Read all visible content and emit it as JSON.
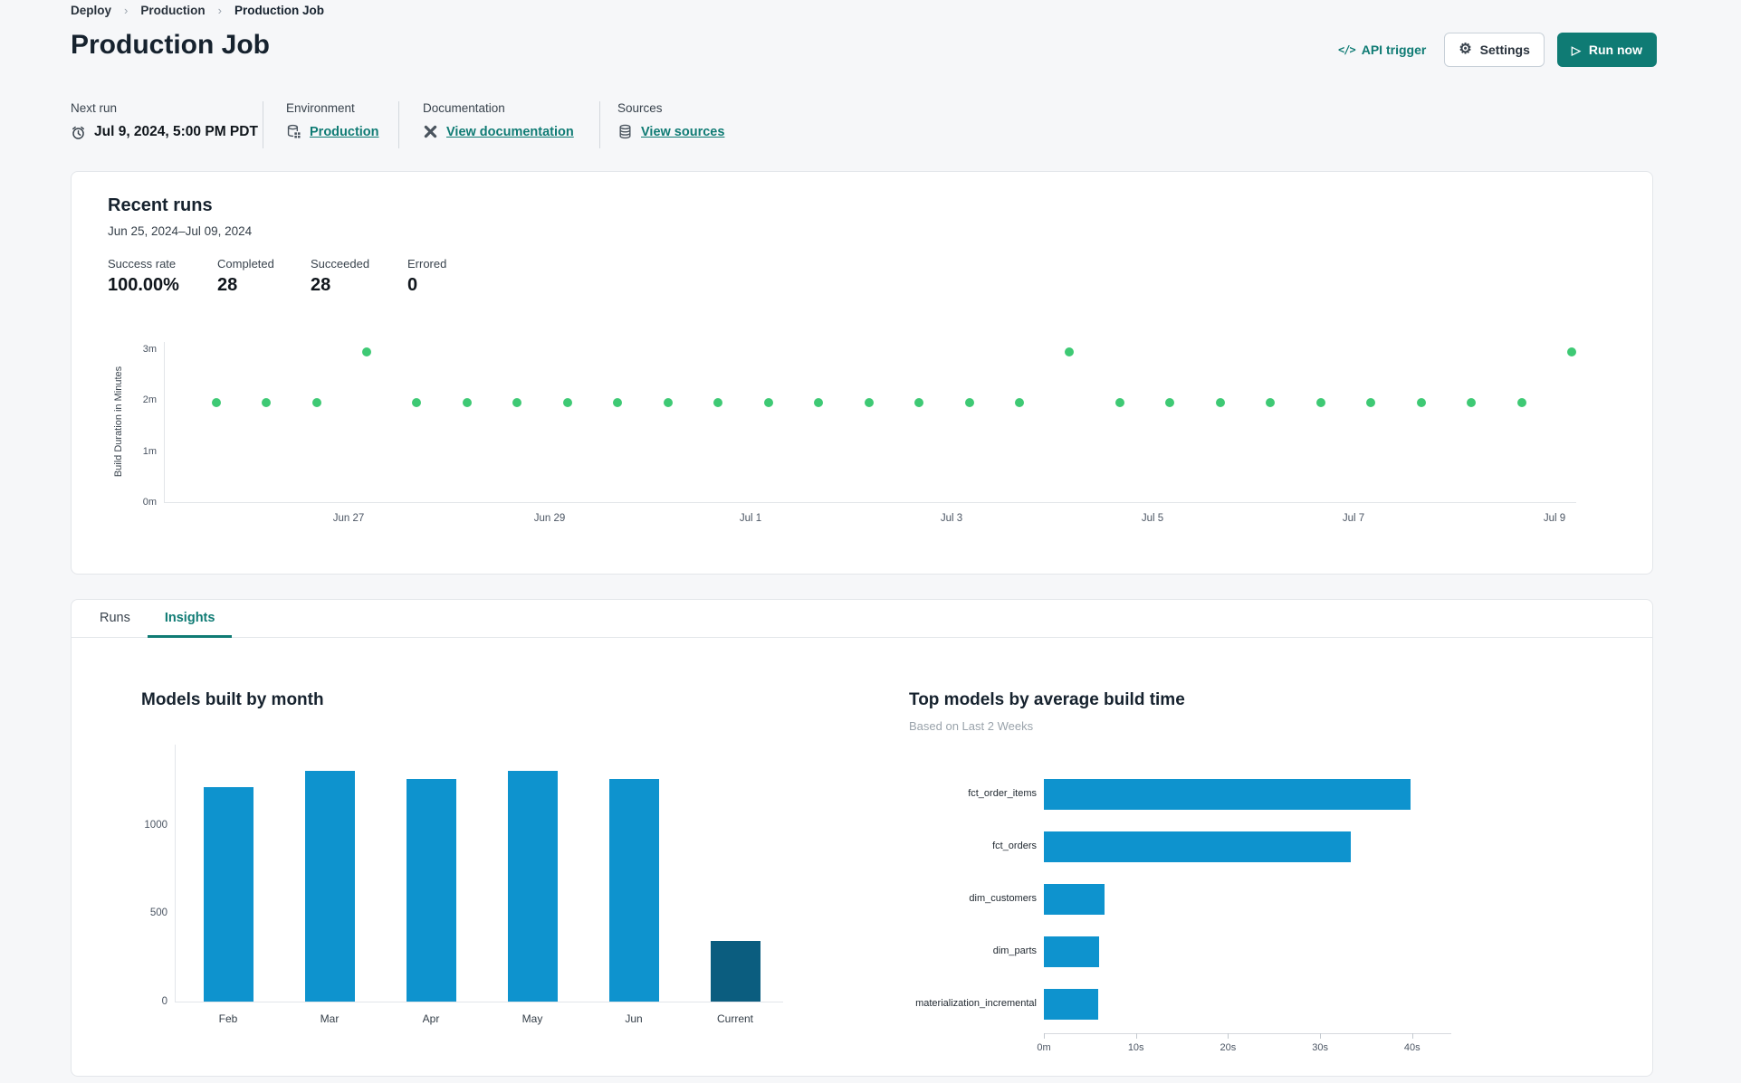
{
  "breadcrumb": {
    "items": [
      {
        "label": "Deploy"
      },
      {
        "label": "Production"
      },
      {
        "label": "Production Job"
      }
    ],
    "separator": "›"
  },
  "header": {
    "title": "Production Job",
    "api_trigger_label": "API trigger",
    "api_trigger_icon": "</>",
    "settings_label": "Settings",
    "settings_icon": "⚙",
    "run_now_label": "Run now",
    "run_now_icon": "▷"
  },
  "info_bar": {
    "groups": [
      {
        "label": "Next run",
        "value": "Jul 9, 2024, 5:00 PM PDT",
        "icon": "alarm-clock-icon",
        "is_link": false
      },
      {
        "label": "Environment",
        "value": "Production",
        "icon": "environment-stack-icon",
        "is_link": true
      },
      {
        "label": "Documentation",
        "value": "View documentation",
        "icon": "dbt-logo-icon",
        "is_link": true
      },
      {
        "label": "Sources",
        "value": "View sources",
        "icon": "database-icon",
        "is_link": true
      }
    ]
  },
  "recent_runs": {
    "title": "Recent runs",
    "date_range": "Jun 25, 2024–Jul 09, 2024",
    "stats": [
      {
        "label": "Success rate",
        "value": "100.00%"
      },
      {
        "label": "Completed",
        "value": "28"
      },
      {
        "label": "Succeeded",
        "value": "28"
      },
      {
        "label": "Errored",
        "value": "0"
      }
    ]
  },
  "tabs": [
    {
      "label": "Runs",
      "active": false
    },
    {
      "label": "Insights",
      "active": true
    }
  ],
  "colors": {
    "accent_teal": "#0f7b74",
    "success_green": "#3ec974",
    "chart_blue": "#0e93ce",
    "chart_dark_blue": "#0b5d7f",
    "page_background": "#f6f7f9"
  },
  "chart_data": [
    {
      "type": "scatter",
      "ylabel": "Build Duration in Minutes",
      "yticks": [
        "0m",
        "1m",
        "2m",
        "3m"
      ],
      "xticks": [
        "Jun 27",
        "Jun 29",
        "Jul 1",
        "Jul 3",
        "Jul 5",
        "Jul 7",
        "Jul 9"
      ],
      "x_range": [
        "Jun 25, 2024",
        "Jul 09, 2024"
      ],
      "values_minutes": [
        1.95,
        1.95,
        1.95,
        2.95,
        1.95,
        1.95,
        1.95,
        1.95,
        1.95,
        1.95,
        1.95,
        1.95,
        1.95,
        1.95,
        1.95,
        1.95,
        1.95,
        2.95,
        1.95,
        1.95,
        1.95,
        1.95,
        1.95,
        1.95,
        1.95,
        1.95,
        1.95,
        2.95
      ],
      "point_color": "#3ec974",
      "grid": false
    },
    {
      "type": "bar",
      "title": "Models built by month",
      "categories": [
        "Feb",
        "Mar",
        "Apr",
        "May",
        "Jun",
        "Current"
      ],
      "values": [
        1215,
        1305,
        1260,
        1305,
        1260,
        345
      ],
      "yticks": [
        0,
        500,
        1000
      ],
      "ylim": [
        0,
        1400
      ],
      "bar_color": "#0e93ce",
      "highlight_color": "#0b5d7f",
      "highlight_index": 5,
      "grid": false
    },
    {
      "type": "hbar",
      "title": "Top models by average build time",
      "subtitle": "Based on Last 2 Weeks",
      "categories": [
        "fct_order_items",
        "fct_orders",
        "dim_customers",
        "dim_parts",
        "materialization_incremental"
      ],
      "values_seconds": [
        39.8,
        33.3,
        6.6,
        6.0,
        5.9
      ],
      "xticks": [
        "0m",
        "10s",
        "20s",
        "30s",
        "40s"
      ],
      "xlim_seconds": [
        0,
        44
      ],
      "bar_color": "#0e93ce",
      "grid": false
    }
  ]
}
